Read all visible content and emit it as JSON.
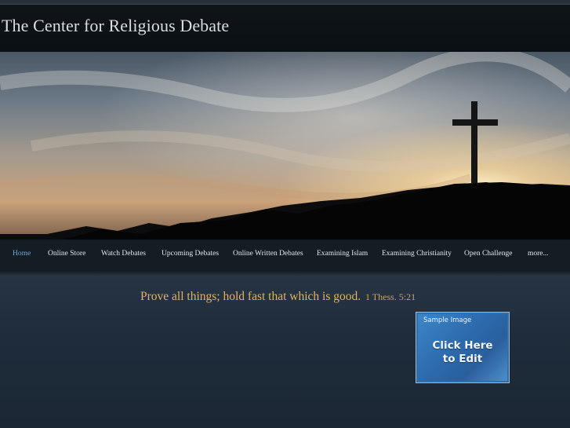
{
  "header": {
    "site_title": "The Center for Religious Debate"
  },
  "banner": {
    "image": "sunset-cross-on-hill"
  },
  "nav": {
    "items": [
      {
        "label": "Home",
        "active": true
      },
      {
        "label": "Online Store",
        "active": false
      },
      {
        "label": "Watch Debates",
        "active": false
      },
      {
        "label": "Upcoming Debates",
        "active": false
      },
      {
        "label": "Online Written Debates",
        "active": false
      },
      {
        "label": "Examining Islam",
        "active": false
      },
      {
        "label": "Examining Christianity",
        "active": false
      },
      {
        "label": "Open Challenge",
        "active": false
      },
      {
        "label": "more...",
        "active": false
      }
    ]
  },
  "main": {
    "quote_text": "Prove all things; hold fast that which is good.",
    "quote_ref": "1 Thess. 5:21",
    "sample_box": {
      "label": "Sample Image",
      "cta_line1": "Click Here",
      "cta_line2": "to Edit"
    }
  },
  "colors": {
    "accent_nav_active": "#6fa7d8",
    "quote": "#e0b45a",
    "page_bg": "#1d2a38"
  }
}
